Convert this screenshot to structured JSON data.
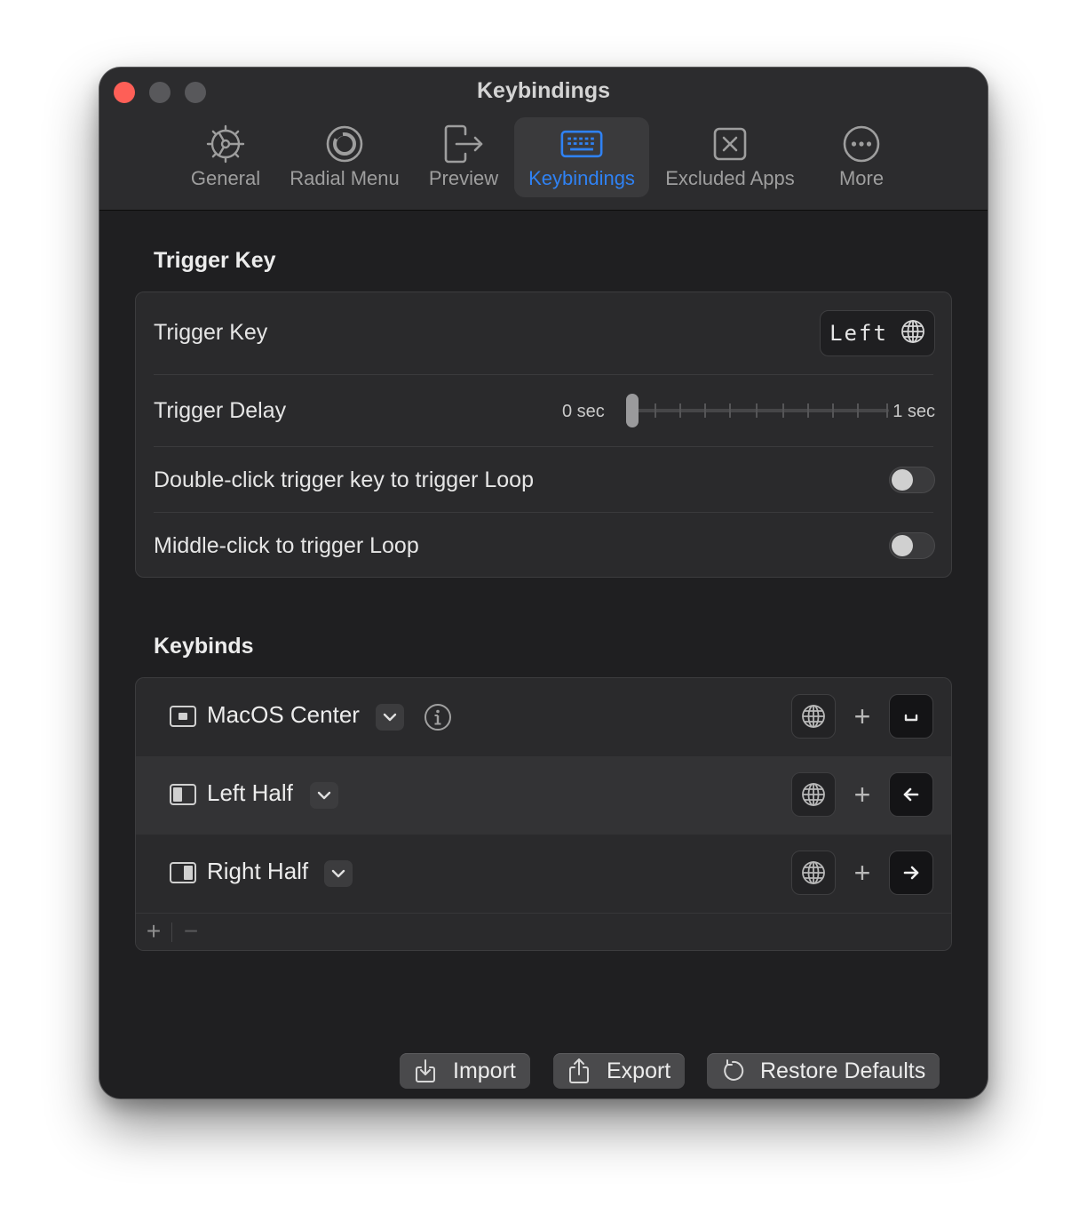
{
  "window": {
    "title": "Keybindings"
  },
  "tabs": [
    {
      "label": "General",
      "icon": "gear-icon"
    },
    {
      "label": "Radial Menu",
      "icon": "radial-circle-icon"
    },
    {
      "label": "Preview",
      "icon": "exit-arrow-icon"
    },
    {
      "label": "Keybindings",
      "icon": "keyboard-icon",
      "active": true
    },
    {
      "label": "Excluded Apps",
      "icon": "x-square-icon"
    },
    {
      "label": "More",
      "icon": "ellipsis-circle-icon"
    }
  ],
  "trigger_section": {
    "title": "Trigger Key",
    "trigger_key": {
      "label": "Trigger Key",
      "value": "Left",
      "icon": "globe-icon"
    },
    "trigger_delay": {
      "label": "Trigger Delay",
      "min_label": "0 sec",
      "max_label": "1 sec",
      "value": 0
    },
    "double_click": {
      "label": "Double-click trigger key to trigger Loop",
      "enabled": false
    },
    "middle_click": {
      "label": "Middle-click to trigger Loop",
      "enabled": false
    }
  },
  "keybinds_section": {
    "title": "Keybinds",
    "items": [
      {
        "name": "MacOS Center",
        "modifier": "globe-icon",
        "plus": "+",
        "key": "space-icon",
        "has_info": true
      },
      {
        "name": "Left Half",
        "modifier": "globe-icon",
        "plus": "+",
        "key": "arrow-left-icon"
      },
      {
        "name": "Right Half",
        "modifier": "globe-icon",
        "plus": "+",
        "key": "arrow-right-icon"
      }
    ],
    "add_label": "+",
    "remove_label": "−"
  },
  "footer_buttons": {
    "import": "Import",
    "export": "Export",
    "restore": "Restore Defaults"
  },
  "colors": {
    "accent": "#2f82f4",
    "close": "#fe5f57",
    "window_bg": "#1f1f21",
    "toolbar_bg": "#2c2c2e"
  }
}
